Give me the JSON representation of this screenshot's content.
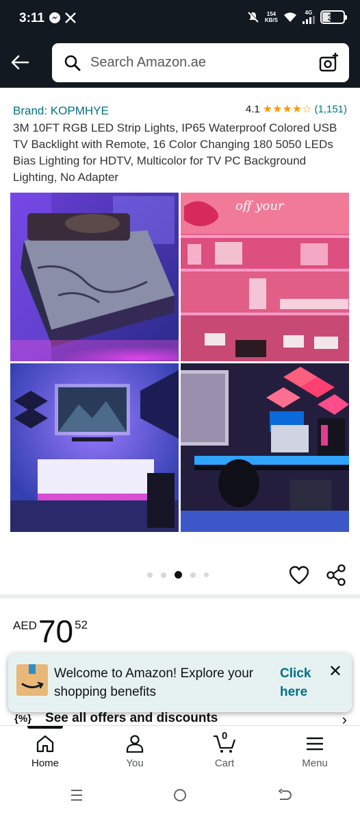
{
  "status_bar": {
    "time": "3:11",
    "net_speed_value": "154",
    "net_speed_unit": "KB/S",
    "network": "4G",
    "battery": "38"
  },
  "header": {
    "search_placeholder": "Search Amazon.ae"
  },
  "product": {
    "brand": "Brand: KOPMHYE",
    "rating": "4.1",
    "stars_filled": 4,
    "rating_count": "(1,151)",
    "title": "3M 10FT RGB LED Strip Lights, IP65 Waterproof Colored USB TV Backlight with Remote, 16 Color Changing 180 5050 LEDs Bias Lighting for HDTV, Multicolor for TV PC Background Lighting, No Adapter",
    "image_tile_text": "off your",
    "carousel_dots": 5,
    "carousel_active_index": 2
  },
  "price": {
    "currency": "AED",
    "whole": "70",
    "fraction": "52"
  },
  "offers": {
    "icon_text": "{%}",
    "label": "See all offers and discounts"
  },
  "toast": {
    "message": "Welcome to Amazon! Explore your shopping benefits",
    "link": "Click here"
  },
  "bottom_nav": {
    "items": [
      {
        "label": "Home",
        "icon": "home-icon"
      },
      {
        "label": "You",
        "icon": "person-icon"
      },
      {
        "label": "Cart",
        "icon": "cart-icon",
        "badge": "0"
      },
      {
        "label": "Menu",
        "icon": "menu-icon"
      }
    ]
  },
  "colors": {
    "header_bg": "#131921",
    "link": "#007185",
    "star": "#ff9900",
    "toast_bg": "#e6f2f2"
  }
}
